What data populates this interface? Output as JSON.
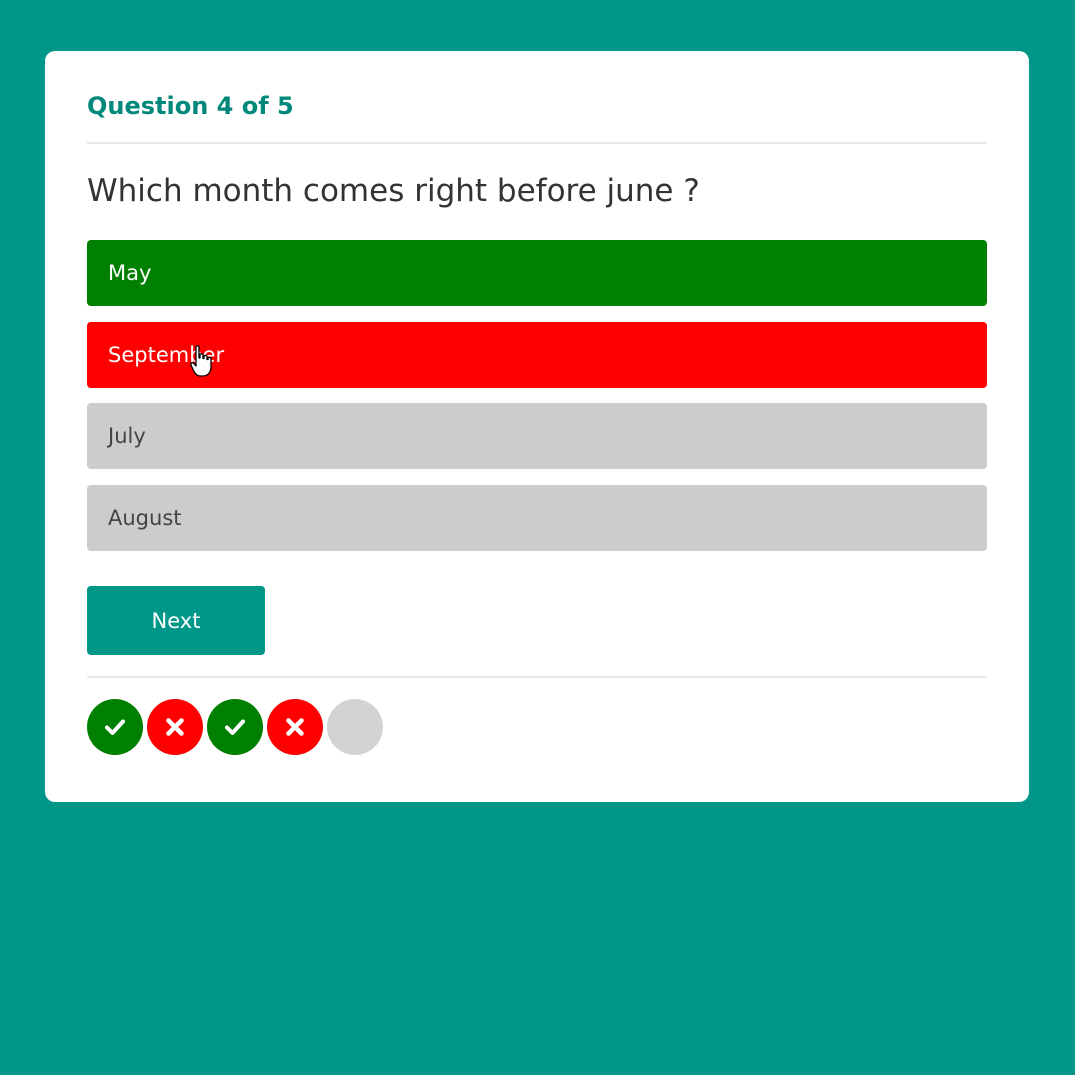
{
  "quiz": {
    "counter": "Question 4 of 5",
    "question": "Which month comes right before june ?",
    "options": [
      {
        "label": "May",
        "state": "correct"
      },
      {
        "label": "September",
        "state": "wrong"
      },
      {
        "label": "July",
        "state": "neutral"
      },
      {
        "label": "August",
        "state": "neutral"
      }
    ],
    "next_label": "Next",
    "progress": [
      {
        "state": "correct",
        "icon": "check-icon"
      },
      {
        "state": "wrong",
        "icon": "x-icon"
      },
      {
        "state": "correct",
        "icon": "check-icon"
      },
      {
        "state": "wrong",
        "icon": "x-icon"
      },
      {
        "state": "pending",
        "icon": "none"
      }
    ]
  },
  "colors": {
    "background": "#009688",
    "accent": "#00897b",
    "correct": "#008000",
    "wrong": "#ff0000",
    "neutral": "#cccccc",
    "pending": "#d3d3d3"
  }
}
